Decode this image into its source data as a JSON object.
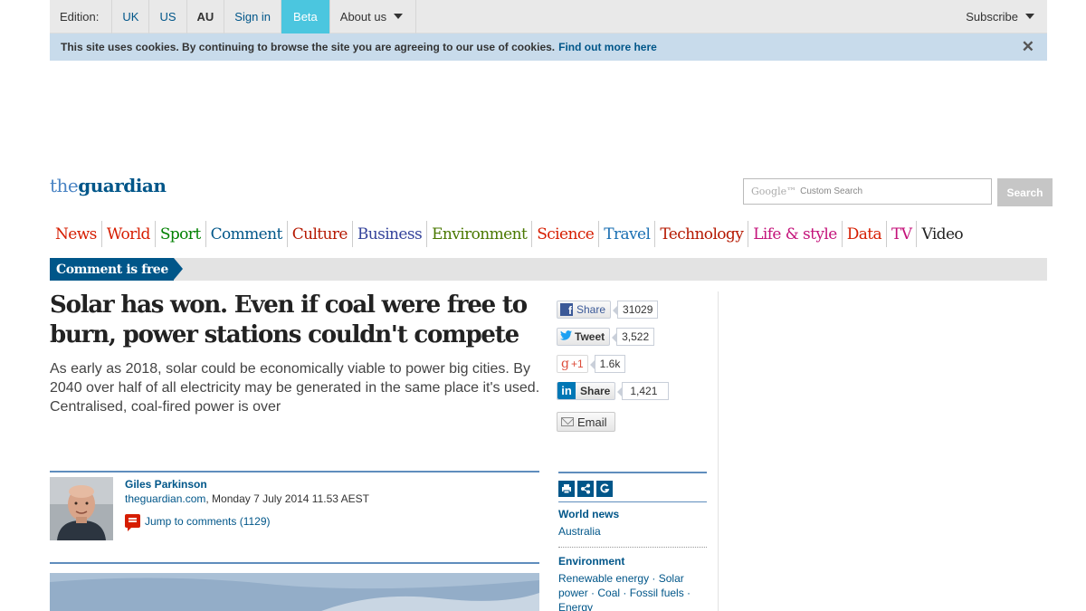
{
  "topbar": {
    "edition_label": "Edition:",
    "editions": [
      "UK",
      "US",
      "AU"
    ],
    "active_edition": "AU",
    "sign_in": "Sign in",
    "beta": "Beta",
    "about_us": "About us",
    "subscribe": "Subscribe"
  },
  "cookie": {
    "message": "This site uses cookies. By continuing to browse the site you are agreeing to our use of cookies.",
    "link": "Find out more here",
    "close": "✕"
  },
  "masthead": {
    "logo_the": "the",
    "logo_guardian": "guardian",
    "search_placeholder": "Custom Search",
    "search_brand": "Google™",
    "search_button": "Search"
  },
  "nav": {
    "items": [
      {
        "label": "News",
        "color": "#d61d00"
      },
      {
        "label": "World",
        "color": "#d61d00"
      },
      {
        "label": "Sport",
        "color": "#008000"
      },
      {
        "label": "Comment",
        "color": "#005689"
      },
      {
        "label": "Culture",
        "color": "#b51800"
      },
      {
        "label": "Business",
        "color": "#34439b"
      },
      {
        "label": "Environment",
        "color": "#4a7801"
      },
      {
        "label": "Science",
        "color": "#d61d00"
      },
      {
        "label": "Travel",
        "color": "#196fb2"
      },
      {
        "label": "Technology",
        "color": "#b51800"
      },
      {
        "label": "Life & style",
        "color": "#c4127a"
      },
      {
        "label": "Data",
        "color": "#d61d00"
      },
      {
        "label": "TV",
        "color": "#c4127a"
      },
      {
        "label": "Video",
        "color": "#222222"
      }
    ]
  },
  "section": {
    "tag": "Comment is free"
  },
  "article": {
    "headline": "Solar has won. Even if coal were free to burn, power stations couldn't compete",
    "standfirst": "As early as 2018, solar could be economically viable to power big cities. By 2040 over half of all electricity may be generated in the same place it's used. Centralised, coal-fired power is over",
    "author": "Giles Parkinson",
    "source": "theguardian.com",
    "date": ", Monday 7 July 2014 11.53 AEST",
    "comments": "Jump to comments (1129)"
  },
  "share": {
    "facebook": {
      "label": "Share",
      "count": "31029"
    },
    "twitter": {
      "label": "Tweet",
      "count": "3,522"
    },
    "googleplus": {
      "label": "+1",
      "count": "1.6k"
    },
    "linkedin": {
      "label": "Share",
      "count": "1,421"
    },
    "email": {
      "label": "Email"
    }
  },
  "keywords": {
    "groups": [
      {
        "head": "World news",
        "links": "Australia"
      },
      {
        "head": "Environment",
        "links": "Renewable energy · Solar power · Coal · Fossil fuels · Energy"
      }
    ]
  },
  "colors": {
    "brand_blue": "#005689",
    "beta_bg": "#4bc6df",
    "cookie_bg": "#c8dbeb"
  }
}
